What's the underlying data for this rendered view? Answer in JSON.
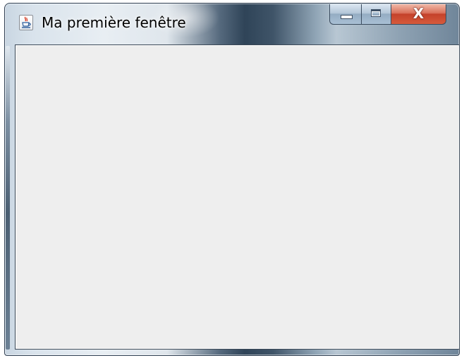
{
  "window": {
    "title": "Ma première fenêtre",
    "app_icon": "java-cup-icon",
    "caption_buttons": {
      "minimize_icon": "minimize-icon",
      "maximize_icon": "maximize-icon",
      "close_label": "X"
    }
  },
  "content": {
    "background_color": "#eeeeee"
  },
  "colors": {
    "close_button": "#c4412a",
    "frame": "#8fa4b5"
  }
}
